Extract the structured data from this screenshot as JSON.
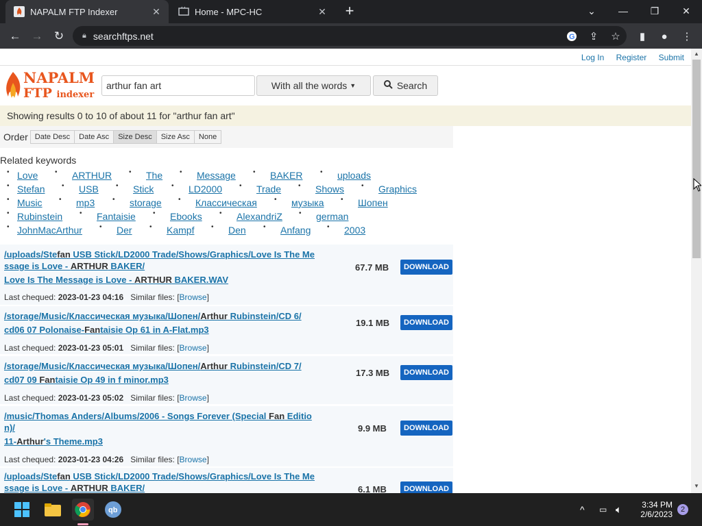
{
  "browser": {
    "tabs": [
      {
        "title": "NAPALM FTP Indexer",
        "active": true
      },
      {
        "title": "Home - MPC-HC",
        "active": false
      }
    ],
    "url": "searchftps.net"
  },
  "site": {
    "toplinks": [
      "Log In",
      "Register",
      "Submit"
    ],
    "logo_line1": "NAPALM",
    "logo_line2a": "FTP",
    "logo_line2b": "indexer",
    "search_value": "arthur fan art",
    "mode_label": "With all the words",
    "search_label": "Search",
    "results_text": "Showing results 0 to 10 of about 11 for \"arthur fan art\"",
    "order_label": "Order",
    "order_options": [
      "Date Desc",
      "Date Asc",
      "Size Desc",
      "Size Asc",
      "None"
    ],
    "order_selected": "Size Desc",
    "related_label": "Related keywords",
    "keywords": [
      "Love",
      "ARTHUR",
      "The",
      "Message",
      "BAKER",
      "uploads",
      "Stefan",
      "USB",
      "Stick",
      "LD2000",
      "Trade",
      "Shows",
      "Graphics",
      "Music",
      "mp3",
      "storage",
      "Классическая",
      "музыка",
      "Шопен",
      "Rubinstein",
      "Fantaisie",
      "Ebooks",
      "AlexandriZ",
      "german",
      "JohnMacArthur",
      "Der",
      "Kampf",
      "Den",
      "Anfang",
      "2003"
    ]
  },
  "results": [
    {
      "path1": "/uploads/Ste",
      "b1": "fan",
      "path2": " USB Stick/LD2000 Trade/Shows/Graphics/Love Is The Me",
      "line2a": "ssage is Love - ",
      "b2": "ARTHUR",
      "line2b": " BAKER/",
      "file_a": "Love Is The Message is Love - ",
      "file_b": "ARTHUR",
      "file_c": " BAKER.WAV",
      "size": "67.7 MB",
      "date": "2023-01-23 04:16"
    },
    {
      "path1": "/storage/Music/Классическая музыка/Шопен/",
      "b1": "Arthur",
      "path2": " Rubinstein/CD 6/",
      "file_a": "cd06 07 Polonaise-",
      "file_b": "Fan",
      "file_c": "taisie Op 61 in A-Flat.mp3",
      "size": "19.1 MB",
      "date": "2023-01-23 05:01"
    },
    {
      "path1": "/storage/Music/Классическая музыка/Шопен/",
      "b1": "Arthur",
      "path2": " Rubinstein/CD 7/",
      "file_a": "cd07 09 ",
      "file_b": "Fan",
      "file_c": "taisie Op 49 in f minor.mp3",
      "size": "17.3 MB",
      "date": "2023-01-23 05:02"
    },
    {
      "path1": "/music/Thomas Anders/Albums/2006 - Songs Forever (Special ",
      "b1": "Fan",
      "path2": " Editio",
      "line2a": "n)/",
      "file_a": "11-",
      "file_b": "Arthur",
      "file_c": "'s Theme.mp3",
      "size": "9.9 MB",
      "date": "2023-01-23 04:26"
    },
    {
      "path1": "/uploads/Ste",
      "b1": "fan",
      "path2": " USB Stick/LD2000 Trade/Shows/Graphics/Love Is The Me",
      "line2a": "ssage is Love - ",
      "b2": "ARTHUR",
      "line2b": " BAKER/",
      "size": "6.1 MB"
    }
  ],
  "labels": {
    "download": "DOWNLOAD",
    "last_cheq": "Last chequed:",
    "similar": "Similar files:",
    "browse": "Browse"
  },
  "taskbar": {
    "time": "3:34 PM",
    "date": "2/6/2023",
    "badge": "2"
  }
}
